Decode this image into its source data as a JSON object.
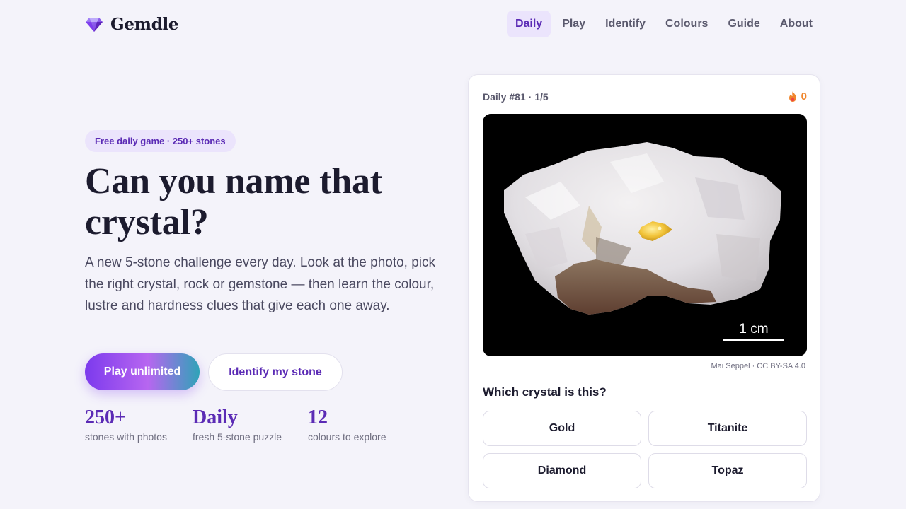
{
  "brand": {
    "name": "Gemdle",
    "logo_icon": "gem-icon",
    "accent": "#7c3aed"
  },
  "nav": {
    "items": [
      {
        "label": "Daily",
        "active": true
      },
      {
        "label": "Play",
        "active": false
      },
      {
        "label": "Identify",
        "active": false
      },
      {
        "label": "Colours",
        "active": false
      },
      {
        "label": "Guide",
        "active": false
      },
      {
        "label": "About",
        "active": false
      }
    ]
  },
  "hero": {
    "pill": "Free daily game · 250+ stones",
    "title": "Can you name that crystal?",
    "text": "A new 5-stone challenge every day. Look at the photo, pick the right crystal, rock or gemstone — then learn the colour, lustre and hardness clues that give each one away.",
    "primary_button": "Play unlimited",
    "secondary_button": "Identify my stone",
    "stats": [
      {
        "value": "250+",
        "label": "stones with photos"
      },
      {
        "value": "Daily",
        "label": "fresh 5-stone puzzle"
      },
      {
        "value": "12",
        "label": "colours to explore"
      }
    ]
  },
  "quiz": {
    "daily_label": "Daily #81 · 1/5",
    "streak_icon": "flame-icon",
    "streak_count": "0",
    "photo": {
      "scale_label": "1 cm",
      "credit": "Mai Seppel · CC BY-SA 4.0"
    },
    "question": "Which crystal is this?",
    "options": [
      "Gold",
      "Titanite",
      "Diamond",
      "Topaz"
    ]
  },
  "colors": {
    "background": "#f4f3fa",
    "primary": "#5b2bb5",
    "streak": "#f0862d",
    "gradient": [
      "#7c3aed",
      "#b766f0",
      "#2fa3b8"
    ]
  }
}
